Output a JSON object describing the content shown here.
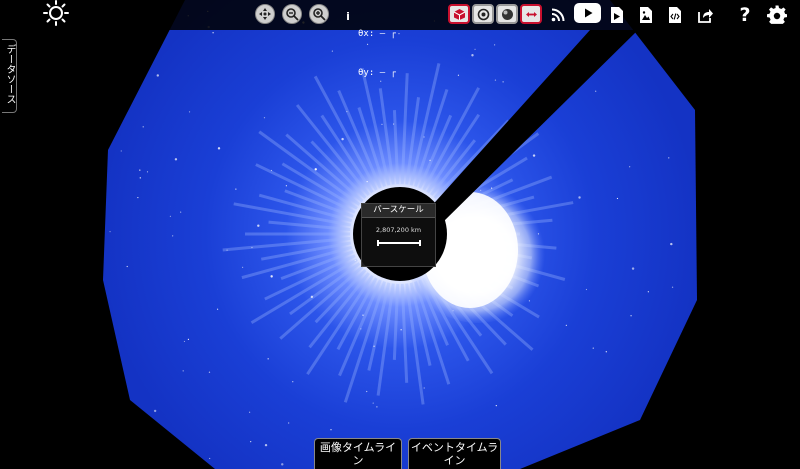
{
  "toolbar": {
    "coords": {
      "x_label": "θx:",
      "x_value": "– ┌",
      "y_label": "θy:",
      "y_value": "– ┌"
    },
    "info_label": "i",
    "help_label": "?"
  },
  "side_tab": {
    "label": "データソース"
  },
  "scale_bar": {
    "title": "バースケール",
    "value": "2,807,200 km"
  },
  "timelines": {
    "image_label": "画像タイムライン",
    "event_label": "イベントタイムライン"
  },
  "colors": {
    "accent_red": "#c8102e",
    "corona_blue": "#1a3fd6",
    "bg": "#000000"
  },
  "icons": [
    "helioviewer-logo-icon",
    "center-icon",
    "zoom-out-icon",
    "zoom-in-icon",
    "info-icon",
    "3d-view-icon",
    "circle-view-icon",
    "sphere-icon",
    "resize-arrow-icon",
    "rss-icon",
    "youtube-icon",
    "movie-icon",
    "image-icon",
    "embed-icon",
    "share-icon",
    "help-icon",
    "settings-icon"
  ]
}
